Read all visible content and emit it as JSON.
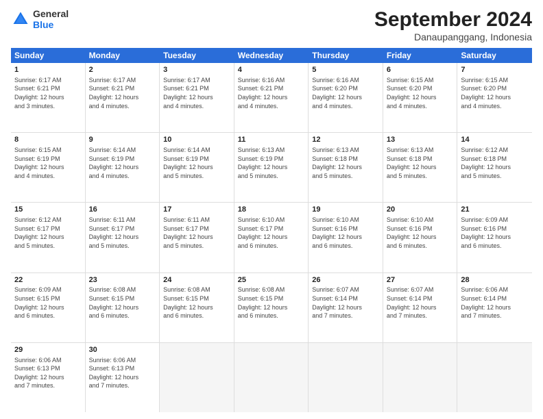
{
  "logo": {
    "text_general": "General",
    "text_blue": "Blue"
  },
  "title": "September 2024",
  "location": "Danaupanggang, Indonesia",
  "days_header": [
    "Sunday",
    "Monday",
    "Tuesday",
    "Wednesday",
    "Thursday",
    "Friday",
    "Saturday"
  ],
  "weeks": [
    [
      {
        "day": "1",
        "info": "Sunrise: 6:17 AM\nSunset: 6:21 PM\nDaylight: 12 hours\nand 3 minutes."
      },
      {
        "day": "2",
        "info": "Sunrise: 6:17 AM\nSunset: 6:21 PM\nDaylight: 12 hours\nand 4 minutes."
      },
      {
        "day": "3",
        "info": "Sunrise: 6:17 AM\nSunset: 6:21 PM\nDaylight: 12 hours\nand 4 minutes."
      },
      {
        "day": "4",
        "info": "Sunrise: 6:16 AM\nSunset: 6:21 PM\nDaylight: 12 hours\nand 4 minutes."
      },
      {
        "day": "5",
        "info": "Sunrise: 6:16 AM\nSunset: 6:20 PM\nDaylight: 12 hours\nand 4 minutes."
      },
      {
        "day": "6",
        "info": "Sunrise: 6:15 AM\nSunset: 6:20 PM\nDaylight: 12 hours\nand 4 minutes."
      },
      {
        "day": "7",
        "info": "Sunrise: 6:15 AM\nSunset: 6:20 PM\nDaylight: 12 hours\nand 4 minutes."
      }
    ],
    [
      {
        "day": "8",
        "info": "Sunrise: 6:15 AM\nSunset: 6:19 PM\nDaylight: 12 hours\nand 4 minutes."
      },
      {
        "day": "9",
        "info": "Sunrise: 6:14 AM\nSunset: 6:19 PM\nDaylight: 12 hours\nand 4 minutes."
      },
      {
        "day": "10",
        "info": "Sunrise: 6:14 AM\nSunset: 6:19 PM\nDaylight: 12 hours\nand 5 minutes."
      },
      {
        "day": "11",
        "info": "Sunrise: 6:13 AM\nSunset: 6:19 PM\nDaylight: 12 hours\nand 5 minutes."
      },
      {
        "day": "12",
        "info": "Sunrise: 6:13 AM\nSunset: 6:18 PM\nDaylight: 12 hours\nand 5 minutes."
      },
      {
        "day": "13",
        "info": "Sunrise: 6:13 AM\nSunset: 6:18 PM\nDaylight: 12 hours\nand 5 minutes."
      },
      {
        "day": "14",
        "info": "Sunrise: 6:12 AM\nSunset: 6:18 PM\nDaylight: 12 hours\nand 5 minutes."
      }
    ],
    [
      {
        "day": "15",
        "info": "Sunrise: 6:12 AM\nSunset: 6:17 PM\nDaylight: 12 hours\nand 5 minutes."
      },
      {
        "day": "16",
        "info": "Sunrise: 6:11 AM\nSunset: 6:17 PM\nDaylight: 12 hours\nand 5 minutes."
      },
      {
        "day": "17",
        "info": "Sunrise: 6:11 AM\nSunset: 6:17 PM\nDaylight: 12 hours\nand 5 minutes."
      },
      {
        "day": "18",
        "info": "Sunrise: 6:10 AM\nSunset: 6:17 PM\nDaylight: 12 hours\nand 6 minutes."
      },
      {
        "day": "19",
        "info": "Sunrise: 6:10 AM\nSunset: 6:16 PM\nDaylight: 12 hours\nand 6 minutes."
      },
      {
        "day": "20",
        "info": "Sunrise: 6:10 AM\nSunset: 6:16 PM\nDaylight: 12 hours\nand 6 minutes."
      },
      {
        "day": "21",
        "info": "Sunrise: 6:09 AM\nSunset: 6:16 PM\nDaylight: 12 hours\nand 6 minutes."
      }
    ],
    [
      {
        "day": "22",
        "info": "Sunrise: 6:09 AM\nSunset: 6:15 PM\nDaylight: 12 hours\nand 6 minutes."
      },
      {
        "day": "23",
        "info": "Sunrise: 6:08 AM\nSunset: 6:15 PM\nDaylight: 12 hours\nand 6 minutes."
      },
      {
        "day": "24",
        "info": "Sunrise: 6:08 AM\nSunset: 6:15 PM\nDaylight: 12 hours\nand 6 minutes."
      },
      {
        "day": "25",
        "info": "Sunrise: 6:08 AM\nSunset: 6:15 PM\nDaylight: 12 hours\nand 6 minutes."
      },
      {
        "day": "26",
        "info": "Sunrise: 6:07 AM\nSunset: 6:14 PM\nDaylight: 12 hours\nand 7 minutes."
      },
      {
        "day": "27",
        "info": "Sunrise: 6:07 AM\nSunset: 6:14 PM\nDaylight: 12 hours\nand 7 minutes."
      },
      {
        "day": "28",
        "info": "Sunrise: 6:06 AM\nSunset: 6:14 PM\nDaylight: 12 hours\nand 7 minutes."
      }
    ],
    [
      {
        "day": "29",
        "info": "Sunrise: 6:06 AM\nSunset: 6:13 PM\nDaylight: 12 hours\nand 7 minutes."
      },
      {
        "day": "30",
        "info": "Sunrise: 6:06 AM\nSunset: 6:13 PM\nDaylight: 12 hours\nand 7 minutes."
      },
      {
        "day": "",
        "info": ""
      },
      {
        "day": "",
        "info": ""
      },
      {
        "day": "",
        "info": ""
      },
      {
        "day": "",
        "info": ""
      },
      {
        "day": "",
        "info": ""
      }
    ]
  ]
}
